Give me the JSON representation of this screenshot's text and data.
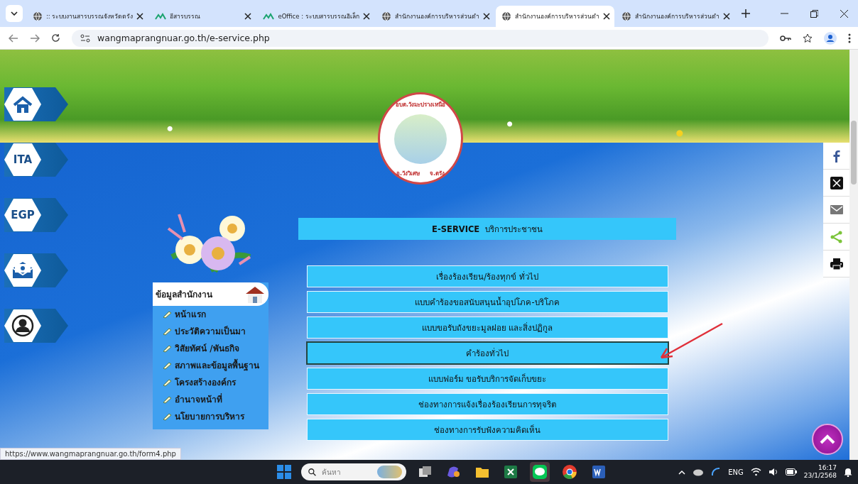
{
  "browser": {
    "tabs": [
      {
        "title": ":: ระบบงานสารบรรณจังหวัดตรัง",
        "kind": "globe",
        "selected": false
      },
      {
        "title": "อีสารบรรณ",
        "kind": "app",
        "selected": false
      },
      {
        "title": "eOffice : ระบบสารบรรณอิเล็ก",
        "kind": "app",
        "selected": false
      },
      {
        "title": "สำนักงานองค์การบริหารส่วนตำ",
        "kind": "globe",
        "selected": false
      },
      {
        "title": "สำนักงานองค์การบริหารส่วนตำ",
        "kind": "globe",
        "selected": true
      },
      {
        "title": "สำนักงานองค์การบริหารส่วนตำ",
        "kind": "globe",
        "selected": false
      }
    ],
    "url": "wangmaprangnuar.go.th/e-service.php"
  },
  "logo": {
    "top_text": "อบต.วังมะปรางเหนือ",
    "bottom_left": "อ.วังวิเศษ",
    "bottom_right": "จ.ตรัง"
  },
  "side_links": [
    {
      "kind": "home"
    },
    {
      "kind": "text",
      "label": "ITA"
    },
    {
      "kind": "text",
      "label": "EGP"
    },
    {
      "kind": "mail"
    },
    {
      "kind": "user"
    }
  ],
  "office_menu": {
    "title": "ข้อมูลสำนักงาน",
    "items": [
      "หน้าแรก",
      "ประวัติความเป็นมา",
      "วิสัยทัศน์ /พันธกิจ",
      "สภาพและข้อมูลพื้นฐาน",
      "โครงสร้างองค์กร",
      "อำนาจหน้าที่",
      "นโยบายการบริหาร"
    ]
  },
  "eservice": {
    "title": "**E-SERVICE** บริการประชาชน",
    "items": [
      {
        "label": "เรื่องร้องเรียน/ร้องทุกข์ ทั่วไป",
        "focused": false
      },
      {
        "label": "แบบคำร้องขอสนับสนุนน้ำอุปโภค-บริโภค",
        "focused": false
      },
      {
        "label": "แบบขอรับถังขยะมูลฝอย และสิ่งปฏิกูล",
        "focused": false
      },
      {
        "label": "คำร้องทั่วไป",
        "focused": true
      },
      {
        "label": "แบบฟอร์ม ขอรับบริการจัดเก็บขยะ",
        "focused": false
      },
      {
        "label": "ช่องทางการแจ้งเรื่องร้องเรียนการทุจริต",
        "focused": false
      },
      {
        "label": "ช่องทางการรับฟังความคิดเห็น",
        "focused": false
      }
    ]
  },
  "share": [
    {
      "kind": "facebook"
    },
    {
      "kind": "x"
    },
    {
      "kind": "mail"
    },
    {
      "kind": "share"
    },
    {
      "kind": "print"
    }
  ],
  "status_link": "https://www.wangmaprangnuar.go.th/form4.php",
  "taskbar": {
    "search_placeholder": "ค้นหา",
    "language": "ENG",
    "time": "16:17",
    "date": "23/1/2568"
  }
}
